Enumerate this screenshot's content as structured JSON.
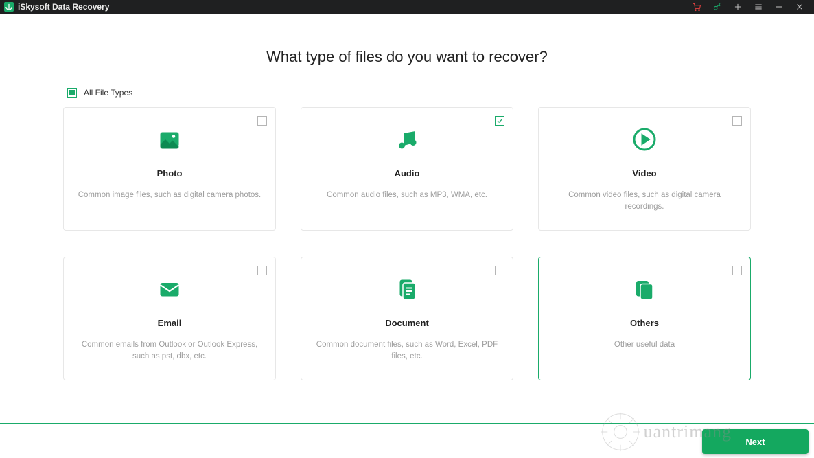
{
  "titlebar": {
    "title": "iSkysoft Data Recovery"
  },
  "heading": "What type of files do you want to recover?",
  "all_label": "All File Types",
  "cards": [
    {
      "title": "Photo",
      "desc": "Common image files, such as digital camera photos.",
      "checked": false
    },
    {
      "title": "Audio",
      "desc": "Common audio files, such as MP3, WMA, etc.",
      "checked": true
    },
    {
      "title": "Video",
      "desc": "Common video files, such as digital camera recordings.",
      "checked": false
    },
    {
      "title": "Email",
      "desc": "Common emails from Outlook or Outlook Express, such as pst, dbx, etc.",
      "checked": false
    },
    {
      "title": "Document",
      "desc": "Common document files, such as Word, Excel, PDF files, etc.",
      "checked": false
    },
    {
      "title": "Others",
      "desc": "Other useful data",
      "checked": false,
      "selected": true
    }
  ],
  "next_label": "Next",
  "watermark": "uantrimang",
  "accent": "#1aab6a"
}
